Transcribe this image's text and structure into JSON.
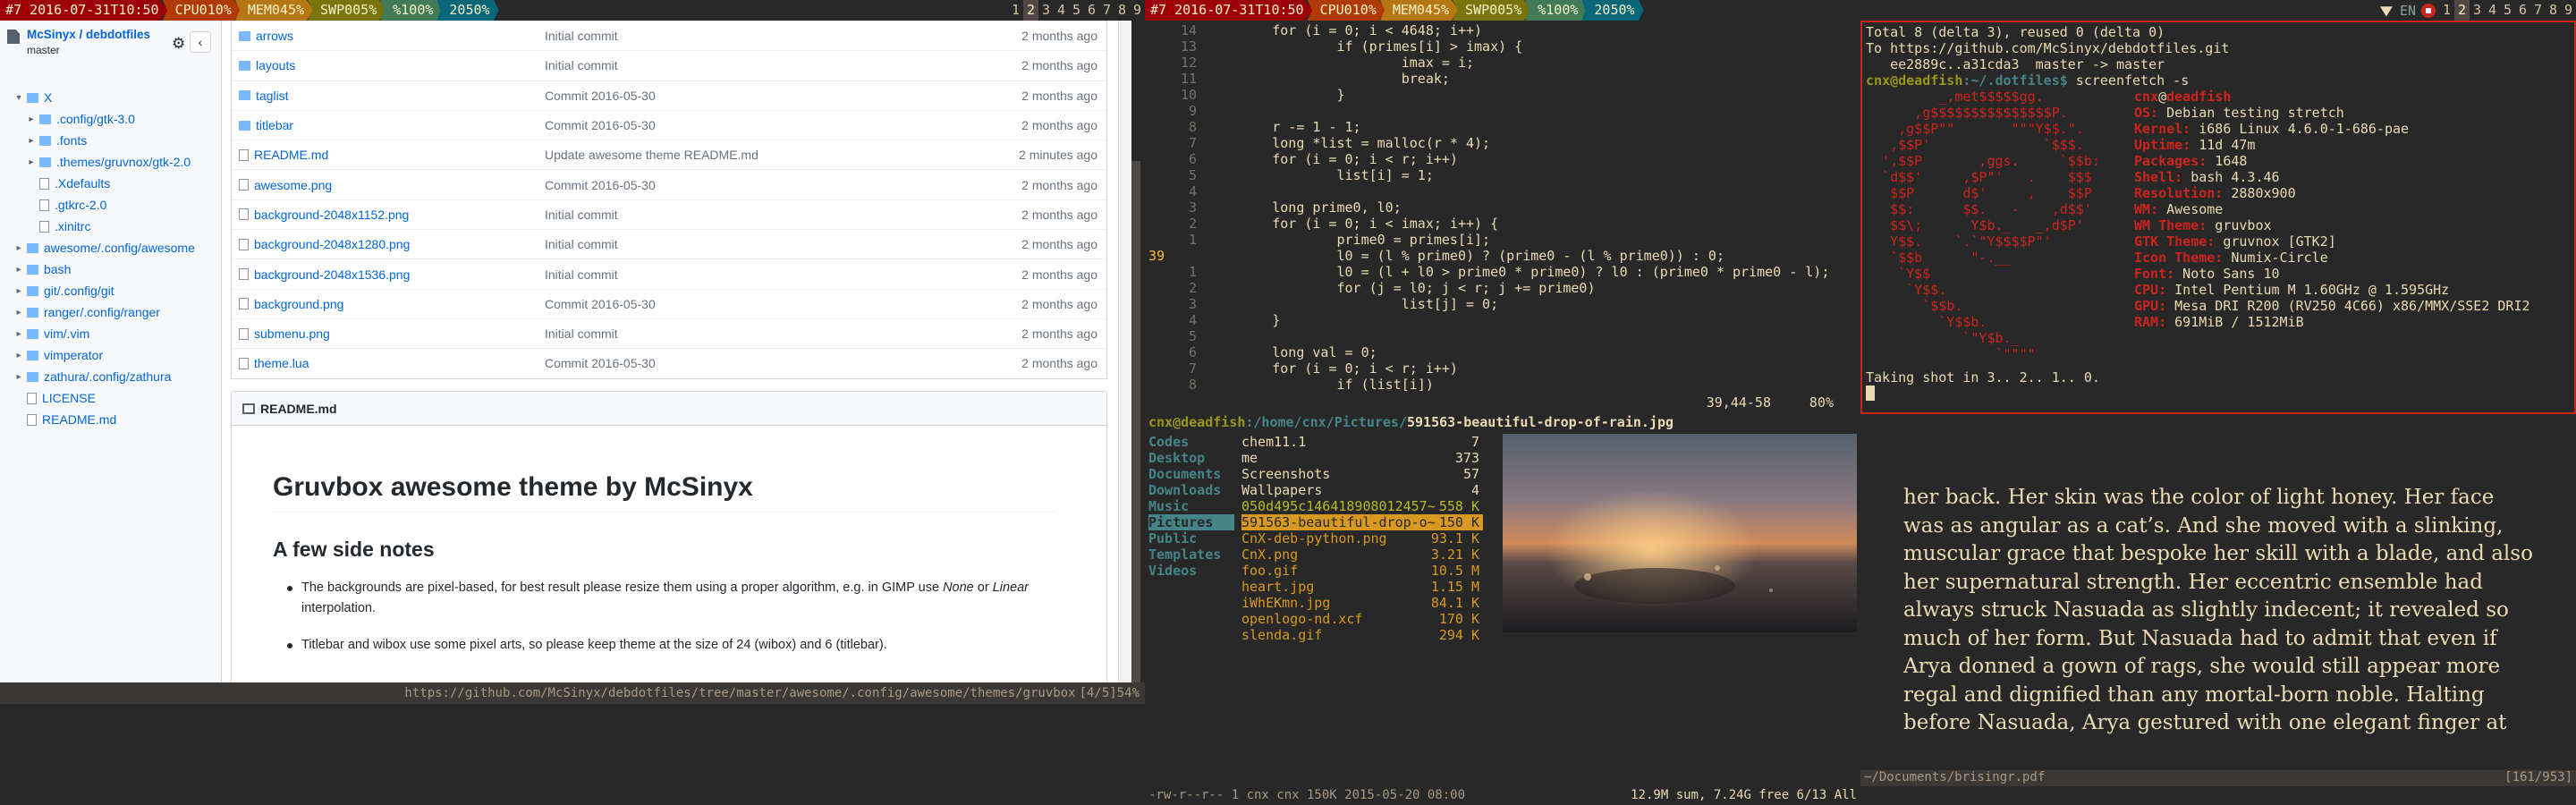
{
  "left_wibox": {
    "date": "#7 2016-07-31T10:50",
    "cpu": "CPU010%",
    "mem": "MEM045%",
    "swp": "SWP005%",
    "vol": "%100%",
    "bat": "2050%",
    "tags": [
      "1",
      "2",
      "3",
      "4",
      "5",
      "6",
      "7",
      "8",
      "9"
    ]
  },
  "right_wibox": {
    "date": "#7 2016-07-31T10:50",
    "cpu": "CPU010%",
    "mem": "MEM045%",
    "swp": "SWP005%",
    "vol": "%100%",
    "bat": "2050%",
    "lang": "EN",
    "tags": [
      "1",
      "2",
      "3",
      "4",
      "5",
      "6",
      "7",
      "8",
      "9"
    ]
  },
  "github": {
    "repo_path": "McSinyx / debdotfiles",
    "branch": "master",
    "tree": [
      {
        "caret": "▾",
        "type": "dir",
        "label": "X",
        "indent": 0
      },
      {
        "caret": "▸",
        "type": "dir",
        "label": ".config/gtk-3.0",
        "indent": 1
      },
      {
        "caret": "▸",
        "type": "dir",
        "label": ".fonts",
        "indent": 1
      },
      {
        "caret": "▸",
        "type": "dir",
        "label": ".themes/gruvnox/gtk-2.0",
        "indent": 1
      },
      {
        "caret": "",
        "type": "file",
        "label": ".Xdefaults",
        "indent": 1
      },
      {
        "caret": "",
        "type": "file",
        "label": ".gtkrc-2.0",
        "indent": 1
      },
      {
        "caret": "",
        "type": "file",
        "label": ".xinitrc",
        "indent": 1
      },
      {
        "caret": "▸",
        "type": "dir",
        "label": "awesome/.config/awesome",
        "indent": 0
      },
      {
        "caret": "▸",
        "type": "dir",
        "label": "bash",
        "indent": 0
      },
      {
        "caret": "▸",
        "type": "dir",
        "label": "git/.config/git",
        "indent": 0
      },
      {
        "caret": "▸",
        "type": "dir",
        "label": "ranger/.config/ranger",
        "indent": 0
      },
      {
        "caret": "▸",
        "type": "dir",
        "label": "vim/.vim",
        "indent": 0
      },
      {
        "caret": "▸",
        "type": "dir",
        "label": "vimperator",
        "indent": 0
      },
      {
        "caret": "▸",
        "type": "dir",
        "label": "zathura/.config/zathura",
        "indent": 0
      },
      {
        "caret": "",
        "type": "file",
        "label": "LICENSE",
        "indent": 0
      },
      {
        "caret": "",
        "type": "file",
        "label": "README.md",
        "indent": 0
      }
    ],
    "files": [
      {
        "type": "dir",
        "name": "arrows",
        "msg": "Initial commit",
        "age": "2 months ago"
      },
      {
        "type": "dir",
        "name": "layouts",
        "msg": "Initial commit",
        "age": "2 months ago"
      },
      {
        "type": "dir",
        "name": "taglist",
        "msg": "Commit 2016-05-30",
        "age": "2 months ago"
      },
      {
        "type": "dir",
        "name": "titlebar",
        "msg": "Commit 2016-05-30",
        "age": "2 months ago"
      },
      {
        "type": "file",
        "name": "README.md",
        "msg": "Update awesome theme README.md",
        "age": "2 minutes ago"
      },
      {
        "type": "file",
        "name": "awesome.png",
        "msg": "Commit 2016-05-30",
        "age": "2 months ago"
      },
      {
        "type": "file",
        "name": "background-2048x1152.png",
        "msg": "Initial commit",
        "age": "2 months ago"
      },
      {
        "type": "file",
        "name": "background-2048x1280.png",
        "msg": "Initial commit",
        "age": "2 months ago"
      },
      {
        "type": "file",
        "name": "background-2048x1536.png",
        "msg": "Initial commit",
        "age": "2 months ago"
      },
      {
        "type": "file",
        "name": "background.png",
        "msg": "Commit 2016-05-30",
        "age": "2 months ago"
      },
      {
        "type": "file",
        "name": "submenu.png",
        "msg": "Initial commit",
        "age": "2 months ago"
      },
      {
        "type": "file",
        "name": "theme.lua",
        "msg": "Commit 2016-05-30",
        "age": "2 months ago"
      }
    ],
    "readme_label": "README.md",
    "readme_h1": "Gruvbox awesome theme by McSinyx",
    "readme_h2": "A few side notes",
    "readme_li1_a": "The backgrounds are pixel-based, for best result please resize them using a proper algorithm, e.g. in GIMP use ",
    "readme_li1_none": "None",
    "readme_li1_or": " or ",
    "readme_li1_linear": "Linear",
    "readme_li1_b": " interpolation.",
    "readme_li2": "Titlebar and wibox use some pixel arts, so please keep theme at the size of 24 (wibox) and 6 (titlebar).",
    "status_url": "https://github.com/McSinyx/debdotfiles/tree/master/awesome/.config/awesome/themes/gruvbox",
    "status_pos": "[4/5]54%"
  },
  "vim": {
    "lines": [
      {
        "n": "14",
        "code": "        for (i = 0; i < 4648; i++)"
      },
      {
        "n": "13",
        "code": "                if (primes[i] > imax) {"
      },
      {
        "n": "12",
        "code": "                        imax = i;"
      },
      {
        "n": "11",
        "code": "                        break;"
      },
      {
        "n": "10",
        "code": "                }"
      },
      {
        "n": "9",
        "code": ""
      },
      {
        "n": "8",
        "code": "        r -= 1 - 1;"
      },
      {
        "n": "7",
        "code": "        long *list = malloc(r * 4);"
      },
      {
        "n": "6",
        "code": "        for (i = 0; i < r; i++)"
      },
      {
        "n": "5",
        "code": "                list[i] = 1;"
      },
      {
        "n": "4",
        "code": ""
      },
      {
        "n": "3",
        "code": "        long prime0, l0;"
      },
      {
        "n": "2",
        "code": "        for (i = 0; i < imax; i++) {"
      },
      {
        "n": "1",
        "code": "                prime0 = primes[i];"
      },
      {
        "n": "39",
        "code": "                l0 = (l % prime0) ? (prime0 - (l % prime0)) : 0;"
      },
      {
        "n": "1",
        "code": "                l0 = (l + l0 > prime0 * prime0) ? l0 : (prime0 * prime0 - l);"
      },
      {
        "n": "2",
        "code": "                for (j = l0; j < r; j += prime0)"
      },
      {
        "n": "3",
        "code": "                        list[j] = 0;"
      },
      {
        "n": "4",
        "code": "        }"
      },
      {
        "n": "5",
        "code": ""
      },
      {
        "n": "6",
        "code": "        long val = 0;"
      },
      {
        "n": "7",
        "code": "        for (i = 0; i < r; i++)"
      },
      {
        "n": "8",
        "code": "                if (list[i])"
      }
    ],
    "status_pos": "39,44-58",
    "status_pct": "80%"
  },
  "ranger": {
    "header_user": "cnx@deadfish",
    "header_path": ":/home/cnx/Pictures/",
    "header_file": "591563-beautiful-drop-of-rain.jpg",
    "col1": [
      "Codes",
      "Desktop",
      "Documents",
      "Downloads",
      "Music",
      "Pictures",
      "Public",
      "Templates",
      "Videos"
    ],
    "col2": [
      {
        "name": "chem11.1",
        "size": "7",
        "cls": "dir"
      },
      {
        "name": "me",
        "size": "373",
        "cls": "dir"
      },
      {
        "name": "Screenshots",
        "size": "57",
        "cls": "dir"
      },
      {
        "name": "Wallpapers",
        "size": "4",
        "cls": "dir"
      },
      {
        "name": "050d495c146418908012457~",
        "size": "558 K",
        "cls": "img"
      },
      {
        "name": "591563-beautiful-drop-o~",
        "size": "150 K",
        "cls": "sel"
      },
      {
        "name": "CnX-deb-python.png",
        "size": "93.1 K",
        "cls": "img"
      },
      {
        "name": "CnX.png",
        "size": "3.21 K",
        "cls": "img"
      },
      {
        "name": "foo.gif",
        "size": "10.5 M",
        "cls": "img"
      },
      {
        "name": "heart.jpg",
        "size": "1.15 M",
        "cls": "img"
      },
      {
        "name": "iWhEKmn.jpg",
        "size": "84.1 K",
        "cls": "img"
      },
      {
        "name": "openlogo-nd.xcf",
        "size": "170 K",
        "cls": "img"
      },
      {
        "name": "slenda.gif",
        "size": "294 K",
        "cls": "img"
      }
    ],
    "status_left": "-rw-r--r-- 1 cnx cnx 150K 2015-05-20 08:00",
    "status_right": "12.9M sum, 7.24G free  6/13  All"
  },
  "terminal": {
    "git_line1": "Total 8 (delta 3), reused 0 (delta 0)",
    "git_line2": "To https://github.com/McSinyx/debdotfiles.git",
    "git_line3": "   ee2889c..a31cda3  master -> master",
    "prompt_user": "cnx@deadfish",
    "prompt_path": ":~/.dotfiles$",
    "prompt_cmd": " screenfetch -s",
    "logo": [
      "         _,met$$$$$gg.",
      "      ,g$$$$$$$$$$$$$$$P.",
      "    ,g$$P\"\"       \"\"\"Y$$.\".",
      "   ,$$P'              `$$$.",
      "  ',$$P       ,ggs.     `$$b:",
      "  `d$$'     ,$P\"'   .    $$$",
      "   $$P      d$'     ,    $$P",
      "   $$:      $$.   -    ,d$$'",
      "   $$\\;      Y$b._   _,d$P'",
      "   Y$$.    `.`\"Y$$$$P\"'",
      "   `$$b      \"-.__",
      "    `Y$$",
      "     `Y$$.",
      "       `$$b.",
      "         `Y$$b.",
      "            `\"Y$b._",
      "                `\"\"\"\""
    ],
    "info_title_user": "cnx",
    "info_title_host": "deadfish",
    "info": [
      {
        "k": "OS:",
        "v": " Debian testing stretch"
      },
      {
        "k": "Kernel:",
        "v": " i686 Linux 4.6.0-1-686-pae"
      },
      {
        "k": "Uptime:",
        "v": " 11d 47m"
      },
      {
        "k": "Packages:",
        "v": " 1648"
      },
      {
        "k": "Shell:",
        "v": " bash 4.3.46"
      },
      {
        "k": "Resolution:",
        "v": " 2880x900"
      },
      {
        "k": "WM:",
        "v": " Awesome"
      },
      {
        "k": "WM Theme:",
        "v": " gruvbox"
      },
      {
        "k": "GTK Theme:",
        "v": " gruvnox [GTK2]"
      },
      {
        "k": "Icon Theme:",
        "v": " Numix-Circle"
      },
      {
        "k": "Font:",
        "v": " Noto Sans 10"
      },
      {
        "k": "CPU:",
        "v": " Intel Pentium M 1.60GHz @ 1.595GHz"
      },
      {
        "k": "GPU:",
        "v": " Mesa DRI R200 (RV250 4C66) x86/MMX/SSE2 DRI2"
      },
      {
        "k": "RAM:",
        "v": " 691MiB / 1512MiB"
      }
    ],
    "shot_line": "Taking shot in 3.. 2.. 1.. 0."
  },
  "zathura": {
    "text": "her back. Her skin was the color of light honey. Her face was as angular as a cat’s. And she moved with a slinking, muscular grace that bespoke her skill with a blade, and also her supernatural strength. Her eccentric ensemble had always struck Nasuada as slightly indecent; it revealed so much of her form. But Nasuada had to admit that even if Arya donned a gown of rags, she would still appear more regal and dignified than any mortal-born noble. Halting before Nasuada, Arya gestured with one elegant finger at",
    "status_file": "~/Documents/brisingr.pdf",
    "status_page": "[161/953]"
  },
  "colors": {
    "bg": "#282828",
    "fg": "#ebdbb2",
    "red": "#cc241d",
    "yellow": "#d79921",
    "aqua": "#689d6a",
    "orange": "#d65d0e"
  }
}
